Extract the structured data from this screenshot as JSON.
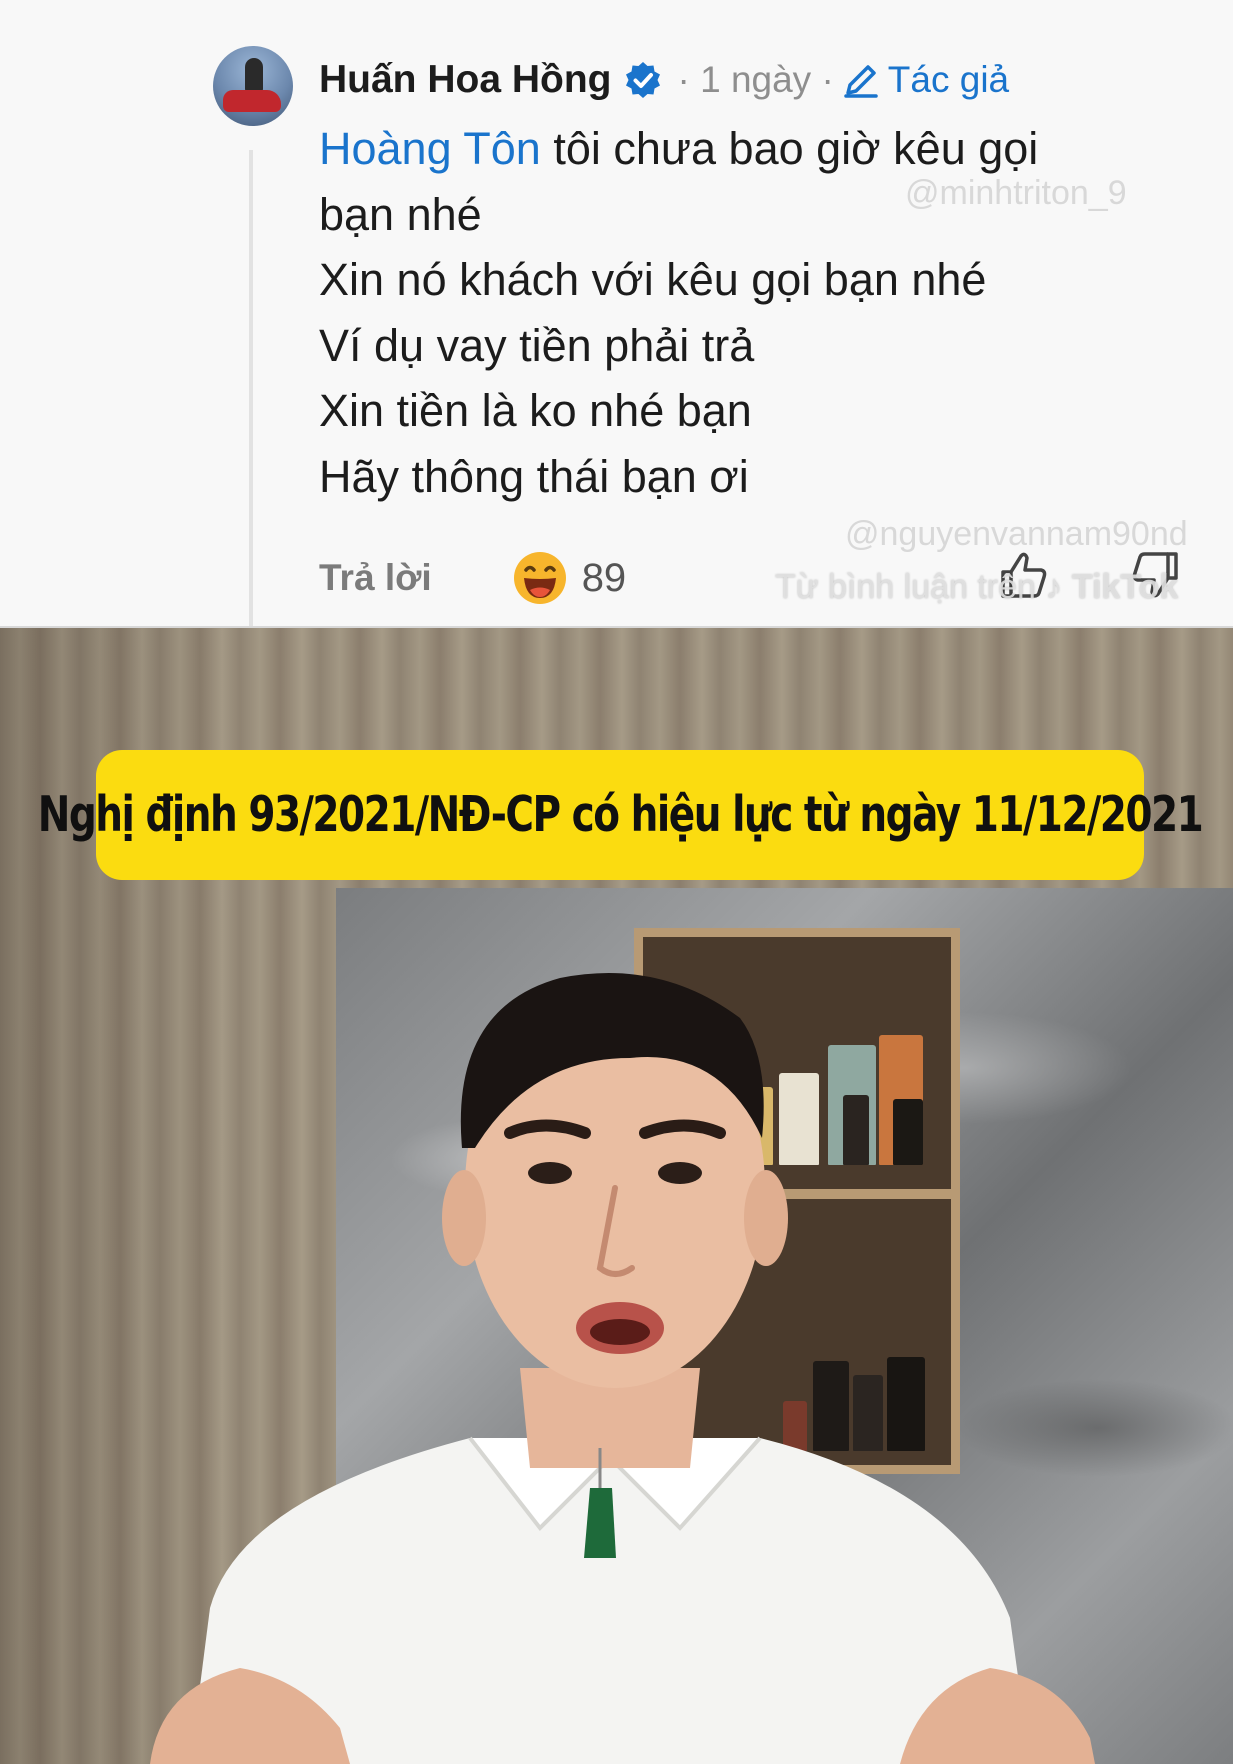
{
  "comment": {
    "author": "Huấn Hoa Hồng",
    "time": "· 1 ngày ·",
    "author_badge": "Tác giả",
    "mention": "Hoàng Tôn",
    "line_1_rest": " tôi chưa bao giờ kêu gọi",
    "lines": [
      "bạn nhé",
      "Xin nó khách với kêu gọi bạn nhé",
      "Ví dụ vay tiền phải trả",
      "Xin tiền là ko nhé bạn",
      "Hãy thông thái bạn ơi"
    ],
    "reply_label": "Trả lời",
    "reaction_count": "89",
    "watermark_top": "@minhtriton_9",
    "watermark_mid": "@nguyenvannam90nd",
    "source_prefix": "Từ bình luận trên",
    "source_brand": "TikTok"
  },
  "video": {
    "banner_text": "Nghị định 93/2021/NĐ-CP có hiệu lực từ ngày 11/12/2021"
  },
  "colors": {
    "accent_blue": "#1a74cc",
    "banner_yellow": "#fbdc10"
  }
}
